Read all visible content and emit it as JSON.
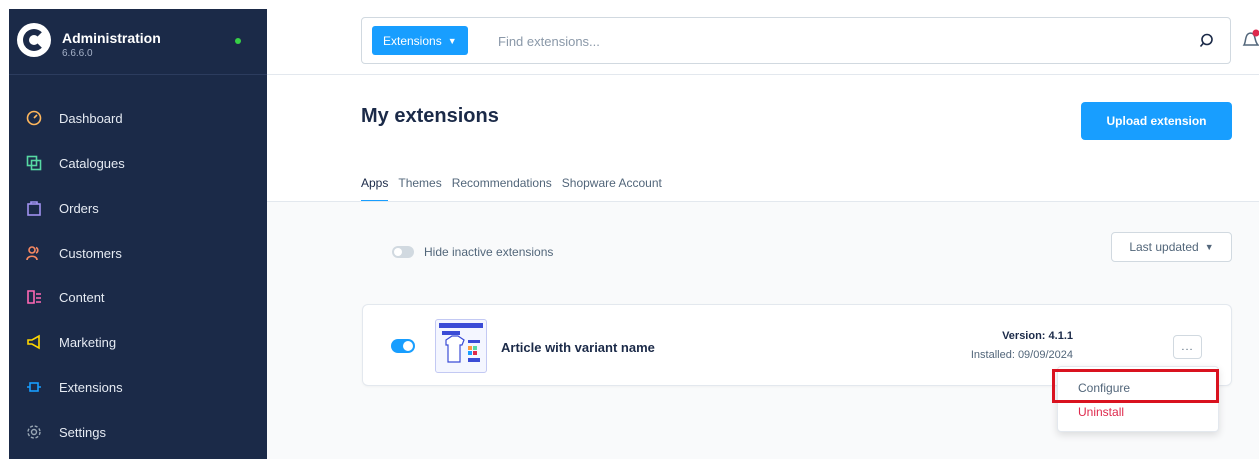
{
  "brand": {
    "title": "Administration",
    "version": "6.6.6.0"
  },
  "sidebar": {
    "items": [
      {
        "label": "Dashboard",
        "icon": "dashboard-icon",
        "color": "#ffb75d"
      },
      {
        "label": "Catalogues",
        "icon": "catalogues-icon",
        "color": "#57d9a3"
      },
      {
        "label": "Orders",
        "icon": "orders-icon",
        "color": "#a092f0"
      },
      {
        "label": "Customers",
        "icon": "customers-icon",
        "color": "#f88962"
      },
      {
        "label": "Content",
        "icon": "content-icon",
        "color": "#ff68b4"
      },
      {
        "label": "Marketing",
        "icon": "marketing-icon",
        "color": "#ffd700"
      },
      {
        "label": "Extensions",
        "icon": "extensions-icon",
        "color": "#189eff"
      },
      {
        "label": "Settings",
        "icon": "settings-icon",
        "color": "#9aa8b5"
      }
    ]
  },
  "search": {
    "type_label": "Extensions",
    "placeholder": "Find extensions..."
  },
  "page": {
    "title": "My extensions",
    "upload_label": "Upload extension"
  },
  "tabs": [
    "Apps",
    "Themes",
    "Recommendations",
    "Shopware Account"
  ],
  "filters": {
    "hide_inactive_label": "Hide inactive extensions",
    "sort_label": "Last updated"
  },
  "extension": {
    "name": "Article with variant name",
    "version": "Version: 4.1.1",
    "installed": "Installed: 09/09/2024",
    "menu_label": "..."
  },
  "context_menu": {
    "configure": "Configure",
    "uninstall": "Uninstall"
  },
  "colors": {
    "primary": "#189eff",
    "sidebar": "#1b2a48",
    "danger": "#de294c",
    "highlight": "#d9121f"
  }
}
